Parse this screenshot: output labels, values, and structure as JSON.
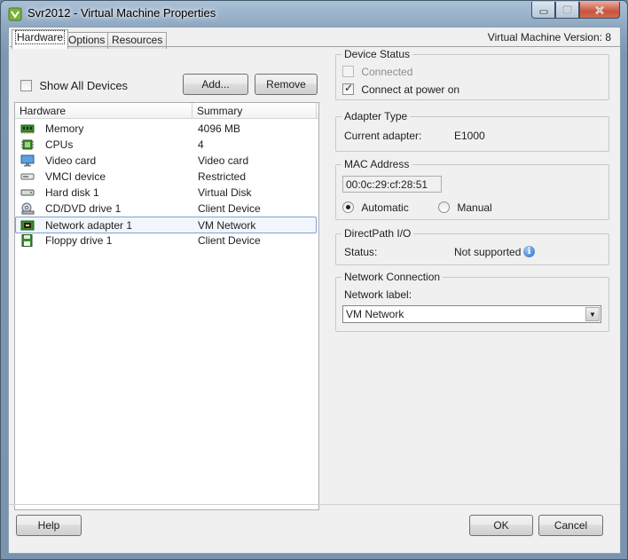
{
  "window": {
    "title": "Svr2012 - Virtual Machine Properties",
    "controls": {
      "minimize_icon": "minimize-icon",
      "maximize_icon": "maximize-icon",
      "close_icon": "close-icon"
    }
  },
  "tabs": [
    {
      "label": "Hardware",
      "active": true
    },
    {
      "label": "Options",
      "active": false
    },
    {
      "label": "Resources",
      "active": false
    }
  ],
  "vm_version": "Virtual Machine Version: 8",
  "show_all_devices": {
    "label": "Show All Devices",
    "checked": false
  },
  "buttons": {
    "add": "Add...",
    "remove": "Remove",
    "help": "Help",
    "ok": "OK",
    "cancel": "Cancel"
  },
  "hardware_table": {
    "columns": [
      "Hardware",
      "Summary"
    ],
    "rows": [
      {
        "icon": "memory-icon",
        "name": "Memory",
        "summary": "4096 MB",
        "selected": false
      },
      {
        "icon": "cpu-icon",
        "name": "CPUs",
        "summary": "4",
        "selected": false
      },
      {
        "icon": "video-card-icon",
        "name": "Video card",
        "summary": "Video card",
        "selected": false
      },
      {
        "icon": "vmci-device-icon",
        "name": "VMCI device",
        "summary": "Restricted",
        "selected": false
      },
      {
        "icon": "hard-disk-icon",
        "name": "Hard disk 1",
        "summary": "Virtual Disk",
        "selected": false
      },
      {
        "icon": "cd-dvd-icon",
        "name": "CD/DVD drive 1",
        "summary": "Client Device",
        "selected": false
      },
      {
        "icon": "network-adapter-icon",
        "name": "Network adapter 1",
        "summary": "VM Network",
        "selected": true
      },
      {
        "icon": "floppy-icon",
        "name": "Floppy drive 1",
        "summary": "Client Device",
        "selected": false
      }
    ]
  },
  "device_status": {
    "title": "Device Status",
    "connected": {
      "label": "Connected",
      "checked": false,
      "enabled": false
    },
    "connect_at_power_on": {
      "label": "Connect at power on",
      "checked": true,
      "enabled": true
    }
  },
  "adapter_type": {
    "title": "Adapter Type",
    "label": "Current adapter:",
    "value": "E1000"
  },
  "mac_address": {
    "title": "MAC Address",
    "value": "00:0c:29:cf:28:51",
    "automatic": {
      "label": "Automatic",
      "selected": true
    },
    "manual": {
      "label": "Manual",
      "selected": false
    }
  },
  "directpath": {
    "title": "DirectPath I/O",
    "label": "Status:",
    "value": "Not supported",
    "icon": "info-icon"
  },
  "network_connection": {
    "title": "Network Connection",
    "label": "Network label:",
    "selected": "VM Network"
  },
  "colors": {
    "selection_border": "#7da2ce",
    "selection_fill": "#f2f6fc",
    "title_bar": "#8fa9c2"
  }
}
